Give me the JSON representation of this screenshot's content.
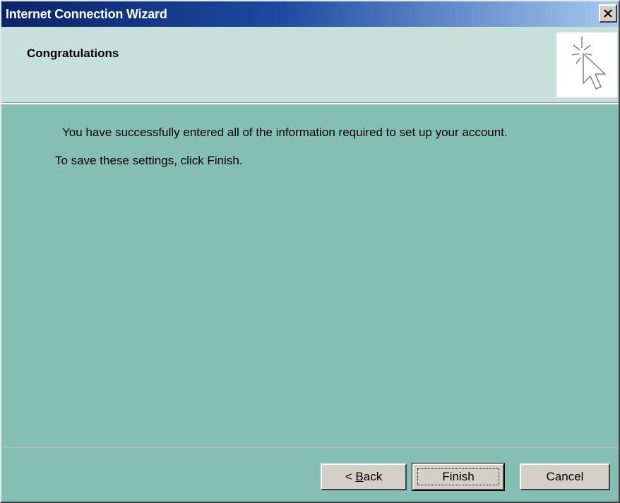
{
  "window": {
    "title": "Internet Connection Wizard",
    "close_icon": "close-icon"
  },
  "header": {
    "heading": "Congratulations",
    "icon": "wizard-pointer-icon"
  },
  "content": {
    "line1": "You have successfully entered all of the information required to set up your account.",
    "line2": "To save these settings, click Finish."
  },
  "buttons": {
    "back_prefix": "< ",
    "back_accel": "B",
    "back_rest": "ack",
    "finish": "Finish",
    "cancel": "Cancel"
  },
  "colors": {
    "body_bg": "#85bfb4",
    "header_bg": "#c7e0da",
    "titlebar_start": "#0a246a",
    "titlebar_end": "#a6caf0",
    "button_face": "#d4d0c8"
  }
}
